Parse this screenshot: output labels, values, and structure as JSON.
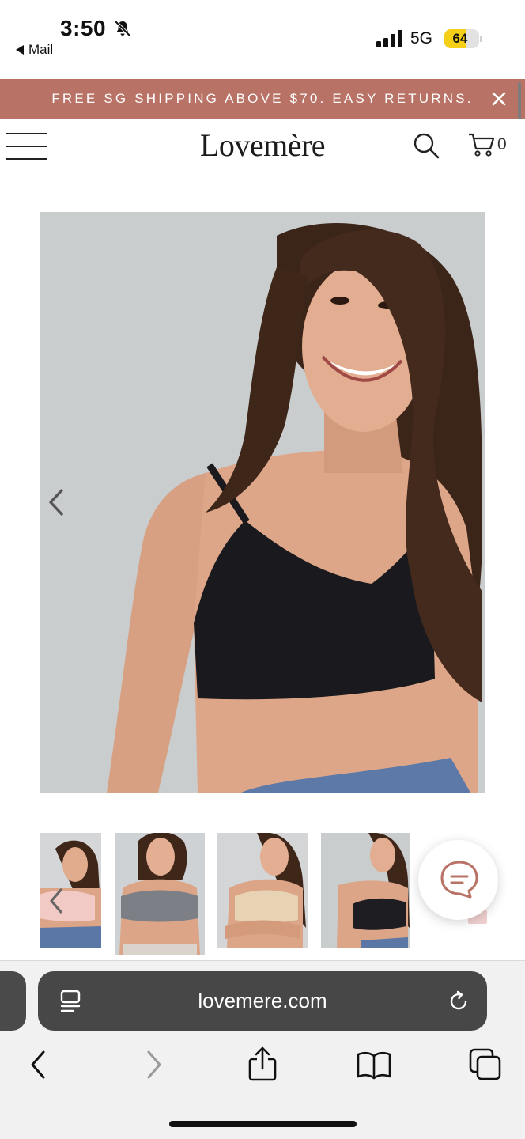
{
  "status_bar": {
    "time": "3:50",
    "back_app": "Mail",
    "network": "5G",
    "battery": "64",
    "battery_fraction": 0.64,
    "icons": [
      "bell-slash-icon",
      "signal-bars-icon"
    ]
  },
  "announcement": {
    "text": "FREE SG SHIPPING ABOVE $70. EASY RETURNS.",
    "close_icon": "close-icon",
    "background": "#b87266"
  },
  "header": {
    "logo": "Lovemère",
    "menu_icon": "hamburger-menu-icon",
    "search_icon": "search-icon",
    "cart_icon": "cart-icon",
    "cart_count": "0"
  },
  "product": {
    "main_image": "model wearing black nursing bra",
    "prev_icon": "chevron-left-icon",
    "thumbnails": [
      {
        "label": "pink bra thumbnail",
        "color": "#f1c9c5"
      },
      {
        "label": "grey bra thumbnail",
        "color": "#7c7f86"
      },
      {
        "label": "nude bra thumbnail",
        "color": "#e8d2b4"
      },
      {
        "label": "black bra thumbnail",
        "color": "#1d1d22"
      }
    ]
  },
  "chat": {
    "icon": "chat-bubble-icon",
    "accent": "#b87266"
  },
  "browser": {
    "url": "lovemere.com",
    "tab_info_icon": "tab-info-icon",
    "reload_icon": "reload-icon",
    "nav": [
      "back-icon",
      "forward-icon",
      "share-icon",
      "bookmarks-icon",
      "tabs-icon"
    ]
  }
}
